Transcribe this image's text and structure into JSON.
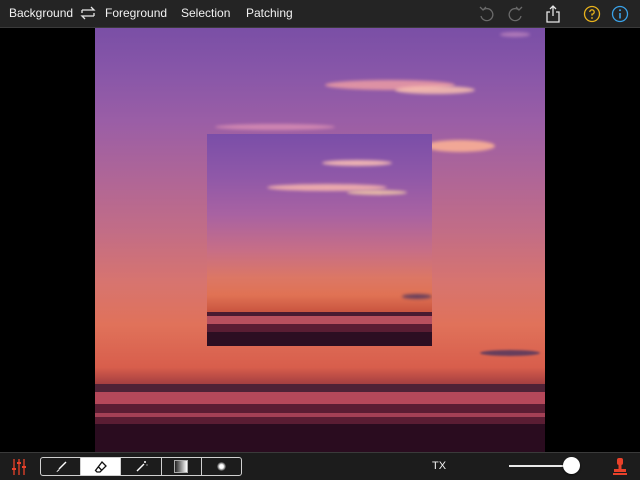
{
  "colors": {
    "toolbar_bg": "#242424",
    "accent_yellow": "#e8b21c",
    "accent_blue": "#3aa2e8",
    "accent_red": "#e8412a",
    "disabled_gray": "#6a6a6a"
  },
  "topbar": {
    "background_label": "Background",
    "foreground_label": "Foreground",
    "selection_label": "Selection",
    "patching_label": "Patching",
    "icons": [
      "swap-icon",
      "undo-icon",
      "redo-icon",
      "share-icon",
      "help-icon",
      "info-icon"
    ]
  },
  "canvas": {
    "image": "sunset over water with inset patch of same scene"
  },
  "bottombar": {
    "tools": [
      "brush-tool",
      "eraser-tool",
      "magic-wand-tool",
      "gradient-tool",
      "soft-brush-tool"
    ],
    "active_tool": "eraser-tool",
    "mode_label": "TX",
    "slider_value": 0.9
  }
}
